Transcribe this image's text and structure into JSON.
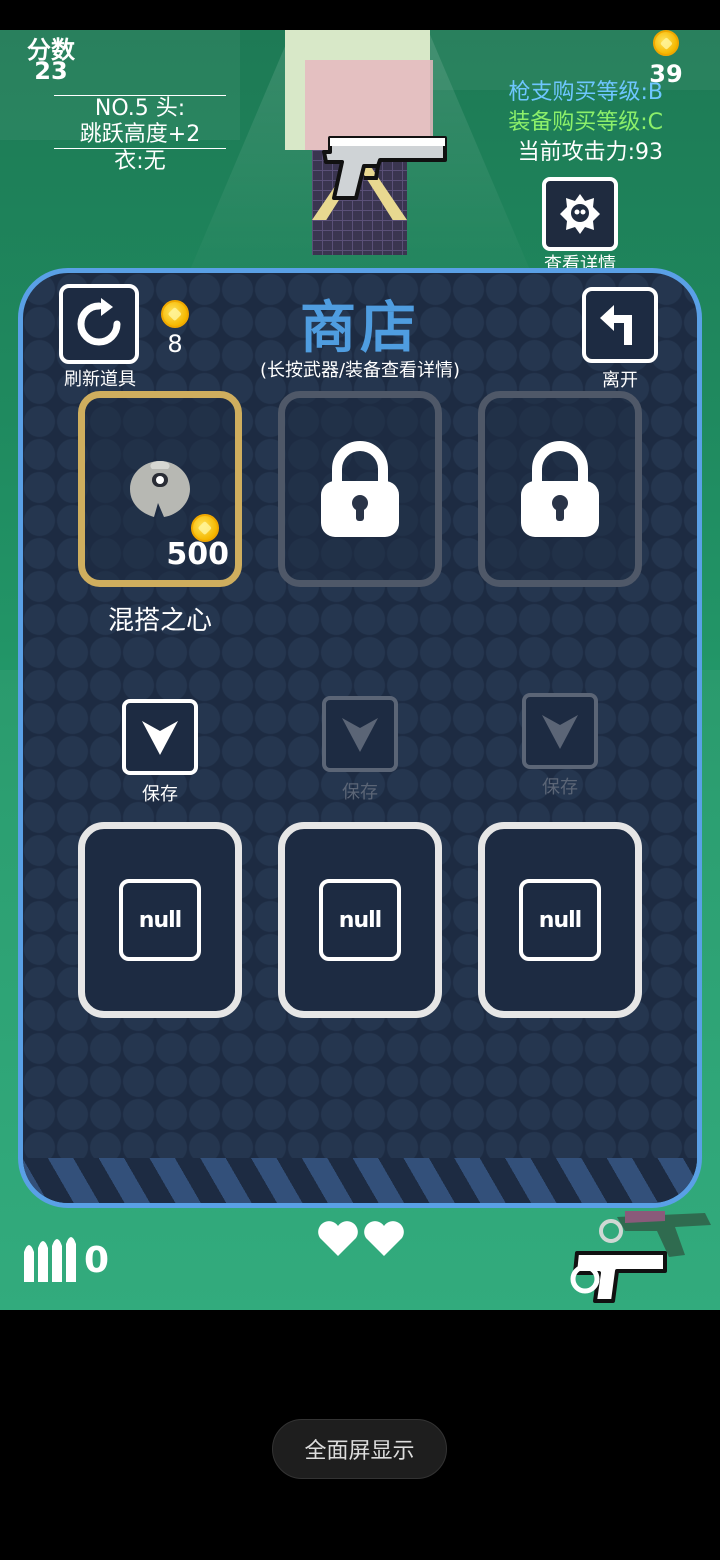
{
  "hud": {
    "score_label": "分数",
    "score_value": "23",
    "equip_line1": "NO.5 头:",
    "equip_line2": "跳跃高度+2",
    "equip_line3": "衣:无",
    "coins": "39",
    "gun_level": "枪支购买等级:B",
    "gear_level": "装备购买等级:C",
    "attack": "当前攻击力:93",
    "detail_label": "查看详情",
    "ammo": "0",
    "hearts": 2
  },
  "shop": {
    "title": "商店",
    "subtitle": "(长按武器/装备查看详情)",
    "refresh_label": "刷新道具",
    "refresh_cost": "8",
    "leave_label": "离开",
    "items": [
      {
        "name": "混搭之心",
        "price": "500",
        "state": "available"
      },
      {
        "name": "",
        "price": "",
        "state": "locked"
      },
      {
        "name": "",
        "price": "",
        "state": "locked"
      }
    ],
    "save_labels": [
      "保存",
      "保存",
      "保存"
    ],
    "equip_slots": [
      "null",
      "null",
      "null"
    ]
  },
  "system": {
    "fullscreen_label": "全面屏显示"
  },
  "colors": {
    "panel_border": "#5aa0e6",
    "title": "#4f9de0",
    "gun_level": "#6ec6ff",
    "gear_level": "#8cf06a",
    "active_slot": "#cfae5e"
  }
}
